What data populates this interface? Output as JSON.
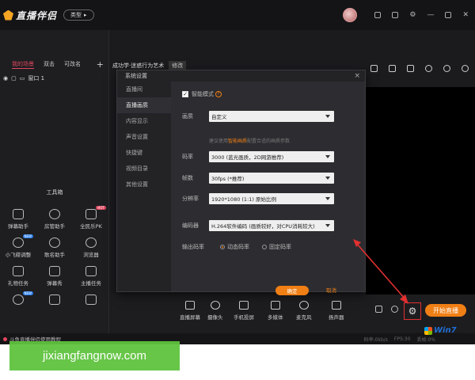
{
  "app": {
    "name": "直播伴侣",
    "type_pill": "类型",
    "caption_icons": [
      "gift-box-icon",
      "message-icon",
      "gear-icon",
      "minimize-icon",
      "maximize-icon",
      "close-icon"
    ]
  },
  "left_panel": {
    "tabs": [
      "我的场景",
      "双击",
      "可改名"
    ],
    "add": "+",
    "scene_item": "窗口 1",
    "toolbox_title": "工具箱",
    "tools": [
      {
        "label": "弹幕助手",
        "icon": "danmaku-icon"
      },
      {
        "label": "房管助手",
        "icon": "moderator-icon"
      },
      {
        "label": "全民乐PK",
        "icon": "pk-icon",
        "badge": "HOT"
      },
      {
        "label": "小飞碟调整",
        "icon": "ufo-icon",
        "badge": "NEW"
      },
      {
        "label": "歌名助手",
        "icon": "song-icon"
      },
      {
        "label": "浏览器",
        "icon": "browser-icon"
      },
      {
        "label": "礼物任务",
        "icon": "gift-task-icon"
      },
      {
        "label": "弹幕秀",
        "icon": "danmaku-show-icon"
      },
      {
        "label": "主播任务",
        "icon": "anchor-task-icon"
      },
      {
        "label": "",
        "icon": "search-tool-icon",
        "badge": "NEW"
      },
      {
        "label": "",
        "icon": "chart-tool-icon"
      },
      {
        "label": "",
        "icon": "pk-tool-icon"
      }
    ]
  },
  "center": {
    "title": "成功学·迷惑行为艺术",
    "chip": "修改"
  },
  "dialog": {
    "title": "系统设置",
    "close": "×",
    "menu": [
      "直播间",
      "直播画质",
      "内容显示",
      "声音设置",
      "快捷键",
      "视频目录",
      "其他设置"
    ],
    "active_menu_index": 1,
    "smart_mode_label": "智能模式",
    "smart_mode_checked": true,
    "quality_label": "画质",
    "quality_value": "自定义",
    "hint_before": "建议使用",
    "hint_link": "智能画质",
    "hint_after": "配置合适的画质参数",
    "bitrate_label": "码率",
    "bitrate_value": "3000 (蓝光画质，2D网游推荐)",
    "fps_label": "帧数",
    "fps_value": "30fps (*推荐)",
    "resolution_label": "分辨率",
    "resolution_value": "1920*1080 (1:1) 原始比例",
    "encoder_label": "编码器",
    "encoder_value": "H.264软件编码 (画质较好，对CPU消耗较大)",
    "output_label": "输出码率",
    "output_options": [
      "动态码率",
      "固定码率"
    ],
    "output_selected": 0,
    "ok": "确定",
    "cancel": "取消"
  },
  "bottom_bar": {
    "items": [
      {
        "label": "直播屏幕",
        "icon": "screen-icon"
      },
      {
        "label": "摄像头",
        "icon": "camera-icon"
      },
      {
        "label": "手机投屏",
        "icon": "phone-cast-icon"
      },
      {
        "label": "多媒体",
        "icon": "media-icon"
      },
      {
        "label": "麦克风",
        "icon": "microphone-icon"
      },
      {
        "label": "扬声器",
        "icon": "speaker-icon"
      }
    ],
    "start": "开始直播"
  },
  "footer": {
    "tip": "斗鱼直播伴侣使用教程",
    "status": [
      "码率:0kb/s",
      "FPS:30",
      "丢帧:0%"
    ]
  },
  "watermarks": {
    "win7": "Win7",
    "site": "jixiangfangnow.com"
  },
  "colors": {
    "accent": "#f07f15",
    "active_tab": "#e0475f",
    "annotation_red": "#e23030"
  }
}
